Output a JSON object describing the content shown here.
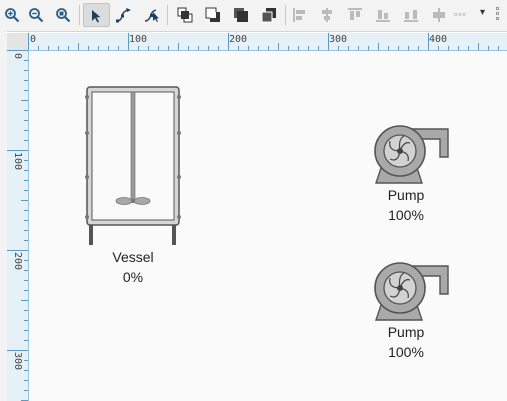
{
  "toolbar": {
    "tools": [
      {
        "name": "zoom-in-icon"
      },
      {
        "name": "zoom-out-icon"
      },
      {
        "name": "zoom-reset-icon"
      },
      {
        "name": "select-pointer-icon",
        "active": true
      },
      {
        "name": "pipe-draw-icon"
      },
      {
        "name": "pipe-edit-icon"
      },
      {
        "name": "bring-to-front-icon"
      },
      {
        "name": "send-to-back-icon"
      },
      {
        "name": "bring-forward-icon"
      },
      {
        "name": "send-backward-icon"
      },
      {
        "name": "align-left-icon"
      },
      {
        "name": "align-center-icon"
      },
      {
        "name": "align-top-icon"
      },
      {
        "name": "align-bottom-icon"
      },
      {
        "name": "distribute-horizontal-icon"
      },
      {
        "name": "distribute-vertical-icon"
      }
    ],
    "more_dots": "▫▫▫",
    "more_caret": "▾"
  },
  "ruler": {
    "horizontal": [
      "0",
      "100",
      "200",
      "300",
      "400"
    ],
    "vertical": [
      "0",
      "100",
      "200",
      "300"
    ]
  },
  "components": {
    "vessel": {
      "label": "Vessel",
      "value": "0%"
    },
    "pump_top": {
      "label": "Pump",
      "value": "100%"
    },
    "pump_bottom": {
      "label": "Pump",
      "value": "100%"
    }
  },
  "colors": {
    "toolbar_bg": "#f3f3f3",
    "ruler_bg": "#e6f1f7",
    "ruler_tick": "#5a9ac4",
    "canvas_bg": "#fafafa",
    "symbol_fill": "#a9a9a9",
    "symbol_stroke": "#555555"
  }
}
